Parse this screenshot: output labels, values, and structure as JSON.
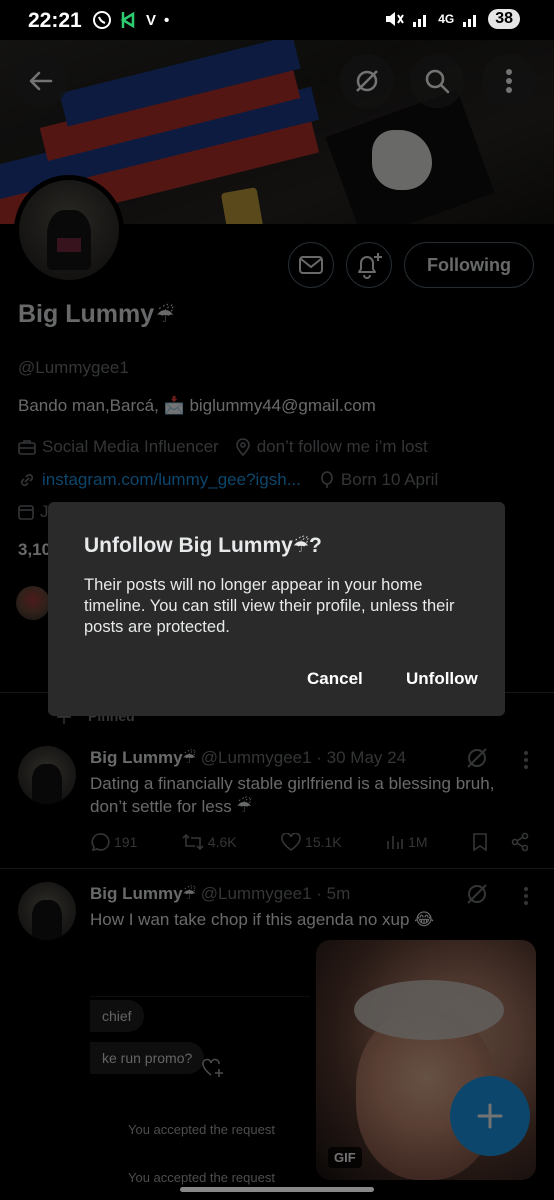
{
  "status_bar": {
    "time": "22:21",
    "left_letter": "V",
    "network": "4G",
    "battery": "38"
  },
  "profile": {
    "display_name": "Big Lummy",
    "name_emoji": "☔",
    "handle": "@Lummygee1",
    "bio_prefix": "Bando man,Barcá,",
    "bio_emoji": "📩",
    "bio_email": "biglummy44@gmail.com",
    "category": "Social Media Influencer",
    "location": "don’t follow me i’m lost",
    "website": "instagram.com/lummy_gee?igsh...",
    "birthday": "Born 10 April",
    "joined_partial": "J",
    "following_partial": "3,10",
    "following_button": "Following"
  },
  "dialog": {
    "title_prefix": "Unfollow Big Lummy",
    "title_emoji": "☔",
    "title_suffix": "?",
    "body": "Their posts will no longer appear in your home timeline. You can still view their profile, unless their posts are protected.",
    "cancel": "Cancel",
    "confirm": "Unfollow"
  },
  "pinned_label": "Pinned",
  "tweets": [
    {
      "name": "Big Lummy",
      "emoji": "☔",
      "meta": "@Lummygee1 · 30 May 24",
      "text": "Dating a financially stable girlfriend is a blessing bruh, don’t settle for less ☔",
      "replies": "191",
      "retweets": "4.6K",
      "likes": "15.1K",
      "views": "1M"
    },
    {
      "name": "Big Lummy",
      "emoji": "☔",
      "meta": "@Lummygee1 · 5m",
      "text": "How I wan take chop if this agenda no xup 😂"
    }
  ],
  "embed": {
    "chip1": "chief",
    "chip2": "ke run promo?",
    "line1": "You accepted the request",
    "line2": "You accepted the request"
  },
  "gif_badge": "GIF",
  "colors": {
    "accent": "#1d9bf0",
    "muted": "#71767b",
    "dialog_bg": "#2a2a2a"
  }
}
